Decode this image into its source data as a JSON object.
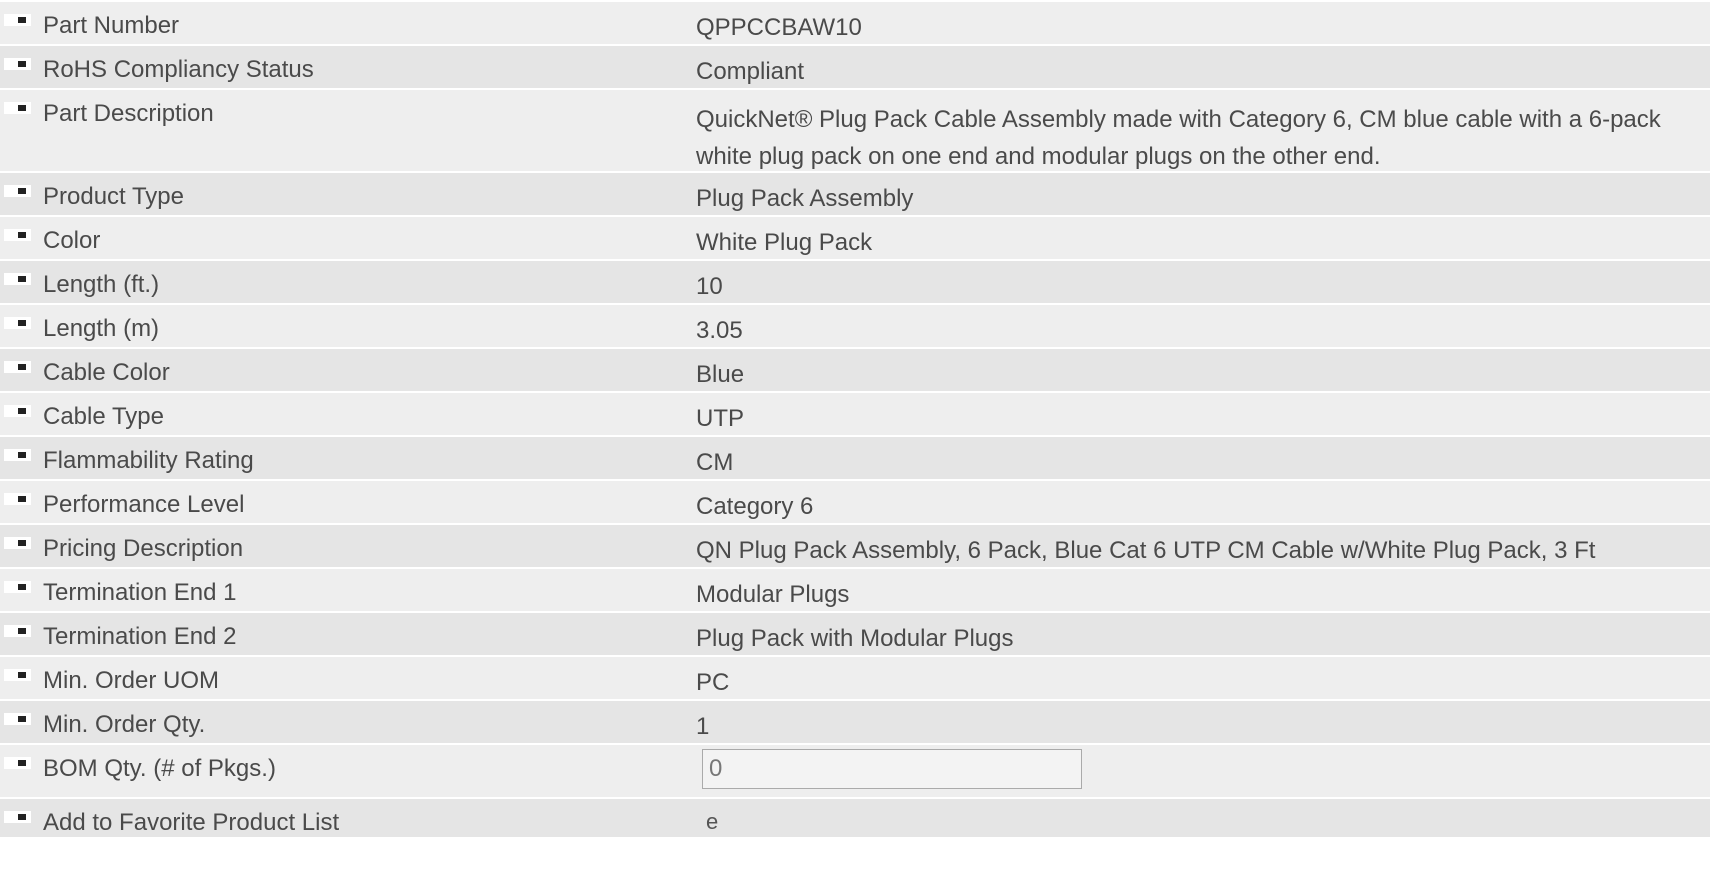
{
  "specs": [
    {
      "label": "Part Number",
      "value": "QPPCCBAW10"
    },
    {
      "label": "RoHS Compliancy Status",
      "value": "Compliant"
    },
    {
      "label": "Part Description",
      "value": "QuickNet® Plug Pack Cable Assembly made with Category 6, CM blue cable with a 6-pack white plug pack on one end and modular plugs on the other end."
    },
    {
      "label": "Product Type",
      "value": "Plug Pack Assembly"
    },
    {
      "label": "Color",
      "value": "White Plug Pack"
    },
    {
      "label": "Length (ft.)",
      "value": "10"
    },
    {
      "label": "Length (m)",
      "value": "3.05"
    },
    {
      "label": "Cable Color",
      "value": "Blue"
    },
    {
      "label": "Cable Type",
      "value": "UTP"
    },
    {
      "label": "Flammability Rating",
      "value": "CM"
    },
    {
      "label": "Performance Level",
      "value": "Category 6"
    },
    {
      "label": "Pricing Description",
      "value": "QN Plug Pack Assembly, 6 Pack, Blue Cat 6 UTP CM Cable w/White Plug Pack, 3 Ft"
    },
    {
      "label": "Termination End 1",
      "value": "Modular Plugs"
    },
    {
      "label": "Termination End 2",
      "value": "Plug Pack with Modular Plugs"
    },
    {
      "label": "Min. Order UOM",
      "value": "PC"
    },
    {
      "label": "Min. Order Qty.",
      "value": "1"
    }
  ],
  "bom": {
    "label": "BOM Qty. (# of Pkgs.)",
    "value": "0"
  },
  "favorite": {
    "label": "Add to Favorite Product List",
    "glyph": "e"
  },
  "icons": {
    "bullet": "square-bullet-icon"
  },
  "colors": {
    "row_odd": "#eeeeee",
    "row_even": "#e5e5e5",
    "text": "#4a4a4a"
  }
}
